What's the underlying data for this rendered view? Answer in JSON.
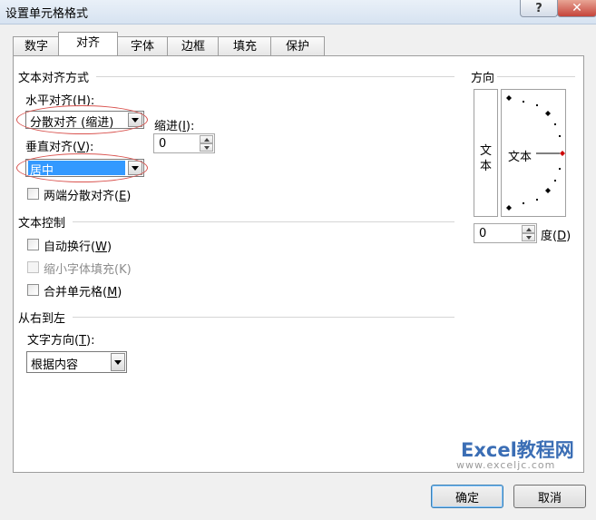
{
  "window": {
    "title": "设置单元格格式",
    "help_label": "?",
    "close_label": "✕"
  },
  "tabs": [
    {
      "label": "数字"
    },
    {
      "label": "对齐",
      "active": true
    },
    {
      "label": "字体"
    },
    {
      "label": "边框"
    },
    {
      "label": "填充"
    },
    {
      "label": "保护"
    }
  ],
  "alignment": {
    "section_label": "文本对齐方式",
    "horizontal_label": "水平对齐(",
    "horizontal_key": "H",
    "horizontal_suffix": "):",
    "horizontal_value": "分散对齐 (缩进)",
    "indent_label": "缩进(",
    "indent_key": "I",
    "indent_suffix": "):",
    "indent_value": "0",
    "vertical_label": "垂直对齐(",
    "vertical_key": "V",
    "vertical_suffix": "):",
    "vertical_value": "居中",
    "justify_distributed_label": "两端分散对齐(",
    "justify_distributed_key": "E",
    "justify_distributed_suffix": ")",
    "justify_distributed_checked": false
  },
  "text_control": {
    "section_label": "文本控制",
    "wrap_text_label": "自动换行(",
    "wrap_text_key": "W",
    "wrap_text_suffix": ")",
    "wrap_text_checked": false,
    "shrink_label": "缩小字体填充(K)",
    "shrink_enabled": false,
    "merge_label": "合并单元格(",
    "merge_key": "M",
    "merge_suffix": ")",
    "merge_checked": false
  },
  "rtl": {
    "section_label": "从右到左",
    "direction_label": "文字方向(",
    "direction_key": "T",
    "direction_suffix": "):",
    "direction_value": "根据内容"
  },
  "orientation": {
    "section_label": "方向",
    "vertical_text": [
      "文",
      "本"
    ],
    "dial_text": "文本",
    "degrees_value": "0",
    "degrees_label": "度(",
    "degrees_key": "D",
    "degrees_suffix": ")"
  },
  "buttons": {
    "ok_label": "确定",
    "cancel_label": "取消"
  },
  "watermark": {
    "brand": "Excel教程网",
    "url": "www.exceljc.com"
  },
  "colors": {
    "highlight_ellipse": "#d9534f",
    "selection": "#3399ff",
    "dial_marker": "#cc0000"
  }
}
